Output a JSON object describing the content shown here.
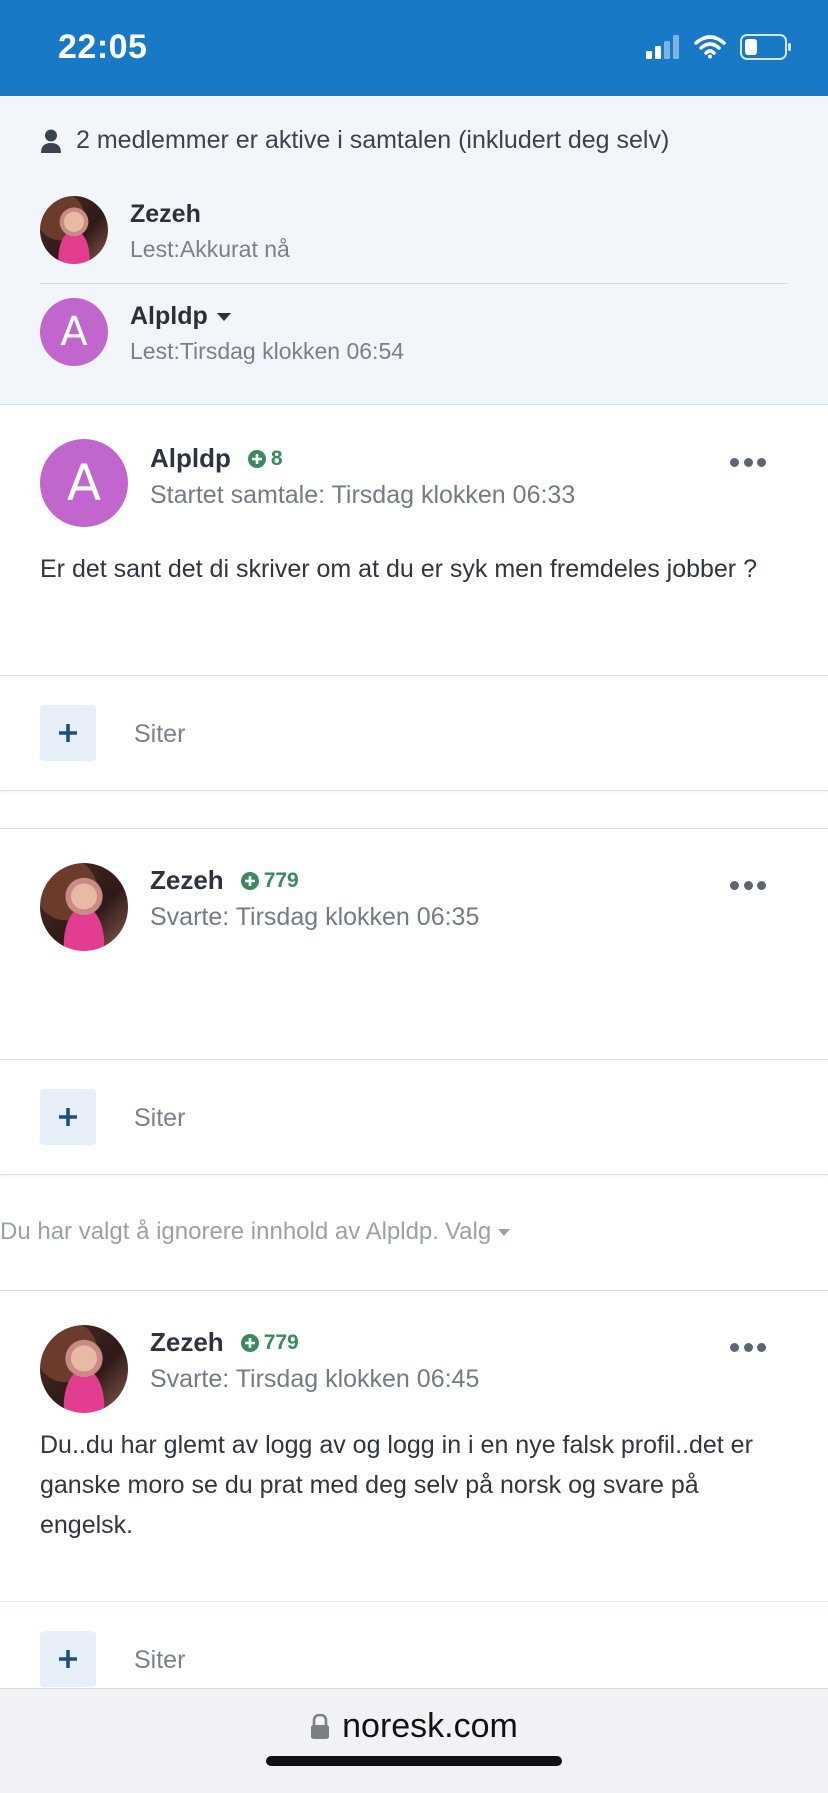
{
  "status_bar": {
    "time": "22:05",
    "bg_color": "#1879c7"
  },
  "conversation_info": {
    "active_members_text": "2 medlemmer er aktive i samtalen (inkludert deg selv)",
    "members": [
      {
        "name": "Zezeh",
        "read": "Lest:Akkurat nå",
        "avatar": "photo"
      },
      {
        "name": "Alpldp",
        "read": "Lest:Tirsdag klokken 06:54",
        "avatar_letter": "A",
        "has_dropdown": true
      }
    ]
  },
  "messages": [
    {
      "author": "Alpldp",
      "score": "8",
      "meta": "Startet samtale: Tirsdag klokken 06:33",
      "body": "Er det sant det di skriver om at du er syk men fremdeles jobber ?",
      "avatar_letter": "A",
      "quote_label": "Siter"
    },
    {
      "author": "Zezeh",
      "score": "779",
      "meta": "Svarte: Tirsdag klokken 06:35",
      "body": "",
      "quote_label": "Siter"
    },
    {
      "author": "Zezeh",
      "score": "779",
      "meta": "Svarte: Tirsdag klokken 06:45",
      "body": "Du..du har glemt av logg av og logg in i en nye falsk profil..det er ganske moro se du prat med deg selv på norsk og svare på engelsk.",
      "quote_label": "Siter"
    }
  ],
  "ignore_notice": {
    "text": "Du har valgt å ignorere innhold av Alpldp.",
    "options_label": "Valg"
  },
  "browser": {
    "url": "noresk.com"
  },
  "colors": {
    "accent": "#1879c7",
    "score_green": "#3a8a5c",
    "avatar_purple": "#c166cc"
  }
}
